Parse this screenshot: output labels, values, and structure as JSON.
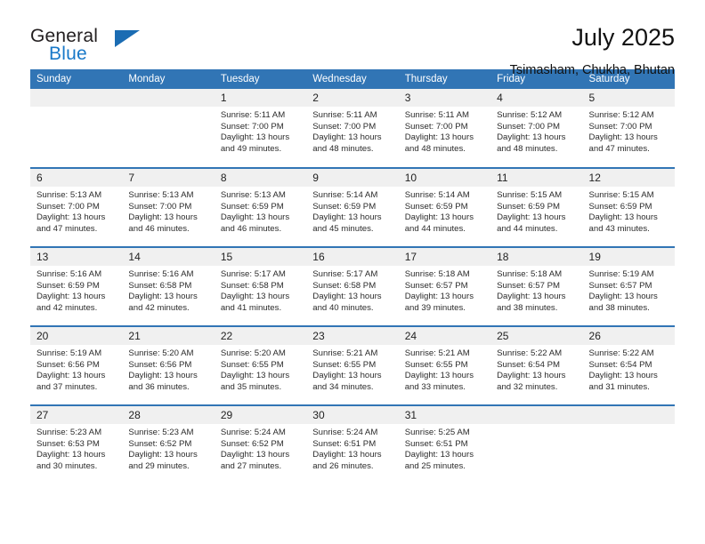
{
  "brand": {
    "name_primary": "General",
    "name_secondary": "Blue",
    "triangle_color": "#1b6cb3",
    "blue_text_color": "#1878c8"
  },
  "header": {
    "title": "July 2025",
    "subtitle": "Tsimasham, Chukha, Bhutan"
  },
  "theme": {
    "header_blue": "#3175b5",
    "day_band_gray": "#f0f0f0"
  },
  "weekday_headers": [
    "Sunday",
    "Monday",
    "Tuesday",
    "Wednesday",
    "Thursday",
    "Friday",
    "Saturday"
  ],
  "weeks": [
    [
      {
        "day": "",
        "sunrise": "",
        "sunset": "",
        "daylight_1": "",
        "daylight_2": ""
      },
      {
        "day": "",
        "sunrise": "",
        "sunset": "",
        "daylight_1": "",
        "daylight_2": ""
      },
      {
        "day": "1",
        "sunrise": "Sunrise: 5:11 AM",
        "sunset": "Sunset: 7:00 PM",
        "daylight_1": "Daylight: 13 hours",
        "daylight_2": "and 49 minutes."
      },
      {
        "day": "2",
        "sunrise": "Sunrise: 5:11 AM",
        "sunset": "Sunset: 7:00 PM",
        "daylight_1": "Daylight: 13 hours",
        "daylight_2": "and 48 minutes."
      },
      {
        "day": "3",
        "sunrise": "Sunrise: 5:11 AM",
        "sunset": "Sunset: 7:00 PM",
        "daylight_1": "Daylight: 13 hours",
        "daylight_2": "and 48 minutes."
      },
      {
        "day": "4",
        "sunrise": "Sunrise: 5:12 AM",
        "sunset": "Sunset: 7:00 PM",
        "daylight_1": "Daylight: 13 hours",
        "daylight_2": "and 48 minutes."
      },
      {
        "day": "5",
        "sunrise": "Sunrise: 5:12 AM",
        "sunset": "Sunset: 7:00 PM",
        "daylight_1": "Daylight: 13 hours",
        "daylight_2": "and 47 minutes."
      }
    ],
    [
      {
        "day": "6",
        "sunrise": "Sunrise: 5:13 AM",
        "sunset": "Sunset: 7:00 PM",
        "daylight_1": "Daylight: 13 hours",
        "daylight_2": "and 47 minutes."
      },
      {
        "day": "7",
        "sunrise": "Sunrise: 5:13 AM",
        "sunset": "Sunset: 7:00 PM",
        "daylight_1": "Daylight: 13 hours",
        "daylight_2": "and 46 minutes."
      },
      {
        "day": "8",
        "sunrise": "Sunrise: 5:13 AM",
        "sunset": "Sunset: 6:59 PM",
        "daylight_1": "Daylight: 13 hours",
        "daylight_2": "and 46 minutes."
      },
      {
        "day": "9",
        "sunrise": "Sunrise: 5:14 AM",
        "sunset": "Sunset: 6:59 PM",
        "daylight_1": "Daylight: 13 hours",
        "daylight_2": "and 45 minutes."
      },
      {
        "day": "10",
        "sunrise": "Sunrise: 5:14 AM",
        "sunset": "Sunset: 6:59 PM",
        "daylight_1": "Daylight: 13 hours",
        "daylight_2": "and 44 minutes."
      },
      {
        "day": "11",
        "sunrise": "Sunrise: 5:15 AM",
        "sunset": "Sunset: 6:59 PM",
        "daylight_1": "Daylight: 13 hours",
        "daylight_2": "and 44 minutes."
      },
      {
        "day": "12",
        "sunrise": "Sunrise: 5:15 AM",
        "sunset": "Sunset: 6:59 PM",
        "daylight_1": "Daylight: 13 hours",
        "daylight_2": "and 43 minutes."
      }
    ],
    [
      {
        "day": "13",
        "sunrise": "Sunrise: 5:16 AM",
        "sunset": "Sunset: 6:59 PM",
        "daylight_1": "Daylight: 13 hours",
        "daylight_2": "and 42 minutes."
      },
      {
        "day": "14",
        "sunrise": "Sunrise: 5:16 AM",
        "sunset": "Sunset: 6:58 PM",
        "daylight_1": "Daylight: 13 hours",
        "daylight_2": "and 42 minutes."
      },
      {
        "day": "15",
        "sunrise": "Sunrise: 5:17 AM",
        "sunset": "Sunset: 6:58 PM",
        "daylight_1": "Daylight: 13 hours",
        "daylight_2": "and 41 minutes."
      },
      {
        "day": "16",
        "sunrise": "Sunrise: 5:17 AM",
        "sunset": "Sunset: 6:58 PM",
        "daylight_1": "Daylight: 13 hours",
        "daylight_2": "and 40 minutes."
      },
      {
        "day": "17",
        "sunrise": "Sunrise: 5:18 AM",
        "sunset": "Sunset: 6:57 PM",
        "daylight_1": "Daylight: 13 hours",
        "daylight_2": "and 39 minutes."
      },
      {
        "day": "18",
        "sunrise": "Sunrise: 5:18 AM",
        "sunset": "Sunset: 6:57 PM",
        "daylight_1": "Daylight: 13 hours",
        "daylight_2": "and 38 minutes."
      },
      {
        "day": "19",
        "sunrise": "Sunrise: 5:19 AM",
        "sunset": "Sunset: 6:57 PM",
        "daylight_1": "Daylight: 13 hours",
        "daylight_2": "and 38 minutes."
      }
    ],
    [
      {
        "day": "20",
        "sunrise": "Sunrise: 5:19 AM",
        "sunset": "Sunset: 6:56 PM",
        "daylight_1": "Daylight: 13 hours",
        "daylight_2": "and 37 minutes."
      },
      {
        "day": "21",
        "sunrise": "Sunrise: 5:20 AM",
        "sunset": "Sunset: 6:56 PM",
        "daylight_1": "Daylight: 13 hours",
        "daylight_2": "and 36 minutes."
      },
      {
        "day": "22",
        "sunrise": "Sunrise: 5:20 AM",
        "sunset": "Sunset: 6:55 PM",
        "daylight_1": "Daylight: 13 hours",
        "daylight_2": "and 35 minutes."
      },
      {
        "day": "23",
        "sunrise": "Sunrise: 5:21 AM",
        "sunset": "Sunset: 6:55 PM",
        "daylight_1": "Daylight: 13 hours",
        "daylight_2": "and 34 minutes."
      },
      {
        "day": "24",
        "sunrise": "Sunrise: 5:21 AM",
        "sunset": "Sunset: 6:55 PM",
        "daylight_1": "Daylight: 13 hours",
        "daylight_2": "and 33 minutes."
      },
      {
        "day": "25",
        "sunrise": "Sunrise: 5:22 AM",
        "sunset": "Sunset: 6:54 PM",
        "daylight_1": "Daylight: 13 hours",
        "daylight_2": "and 32 minutes."
      },
      {
        "day": "26",
        "sunrise": "Sunrise: 5:22 AM",
        "sunset": "Sunset: 6:54 PM",
        "daylight_1": "Daylight: 13 hours",
        "daylight_2": "and 31 minutes."
      }
    ],
    [
      {
        "day": "27",
        "sunrise": "Sunrise: 5:23 AM",
        "sunset": "Sunset: 6:53 PM",
        "daylight_1": "Daylight: 13 hours",
        "daylight_2": "and 30 minutes."
      },
      {
        "day": "28",
        "sunrise": "Sunrise: 5:23 AM",
        "sunset": "Sunset: 6:52 PM",
        "daylight_1": "Daylight: 13 hours",
        "daylight_2": "and 29 minutes."
      },
      {
        "day": "29",
        "sunrise": "Sunrise: 5:24 AM",
        "sunset": "Sunset: 6:52 PM",
        "daylight_1": "Daylight: 13 hours",
        "daylight_2": "and 27 minutes."
      },
      {
        "day": "30",
        "sunrise": "Sunrise: 5:24 AM",
        "sunset": "Sunset: 6:51 PM",
        "daylight_1": "Daylight: 13 hours",
        "daylight_2": "and 26 minutes."
      },
      {
        "day": "31",
        "sunrise": "Sunrise: 5:25 AM",
        "sunset": "Sunset: 6:51 PM",
        "daylight_1": "Daylight: 13 hours",
        "daylight_2": "and 25 minutes."
      },
      {
        "day": "",
        "sunrise": "",
        "sunset": "",
        "daylight_1": "",
        "daylight_2": ""
      },
      {
        "day": "",
        "sunrise": "",
        "sunset": "",
        "daylight_1": "",
        "daylight_2": ""
      }
    ]
  ]
}
